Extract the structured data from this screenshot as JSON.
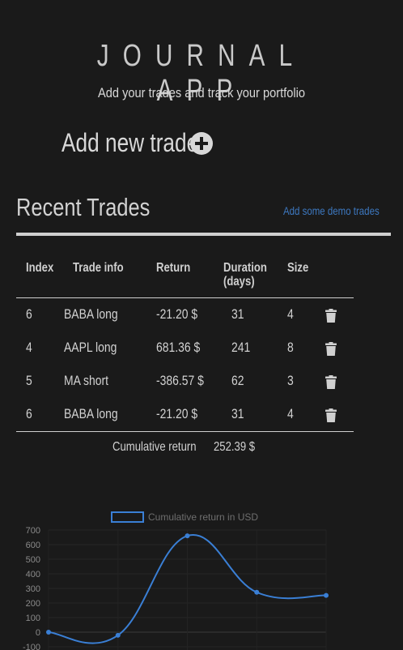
{
  "header": {
    "title": "JOURNAL APP",
    "subtitle": "Add your trades and track your portfolio"
  },
  "add_trade": {
    "label": "Add new trade",
    "icon": "plus-circle-icon"
  },
  "recent": {
    "title": "Recent Trades",
    "demo_link": "Add some demo trades"
  },
  "table": {
    "headers": {
      "index": "Index",
      "info": "Trade info",
      "return": "Return",
      "duration_line1": "Duration",
      "duration_line2": "(days)",
      "size": "Size"
    },
    "rows": [
      {
        "index": "6",
        "info": "BABA long",
        "return": "-21.20 $",
        "duration": "31",
        "size": "4"
      },
      {
        "index": "4",
        "info": "AAPL long",
        "return": "681.36 $",
        "duration": "241",
        "size": "8"
      },
      {
        "index": "5",
        "info": "MA short",
        "return": "-386.57 $",
        "duration": "62",
        "size": "3"
      },
      {
        "index": "6",
        "info": "BABA long",
        "return": "-21.20 $",
        "duration": "31",
        "size": "4"
      }
    ],
    "delete_icon": "trash-icon"
  },
  "cumulative": {
    "label": "Cumulative return",
    "value": "252.39 $"
  },
  "colors": {
    "background": "#1a1a1a",
    "text": "#cfcfcf",
    "accent": "#3d78c0",
    "series": "#3a7fd5"
  },
  "chart_data": {
    "type": "line",
    "series": [
      {
        "name": "Cumulative return in USD",
        "values": [
          0,
          -21.2,
          660.16,
          273.59,
          252.39
        ]
      }
    ],
    "y_ticks": [
      "700",
      "600",
      "500",
      "400",
      "300",
      "200",
      "100",
      "0",
      "-100"
    ],
    "ylim": [
      -100,
      700
    ],
    "grid": true,
    "legend": "top"
  }
}
